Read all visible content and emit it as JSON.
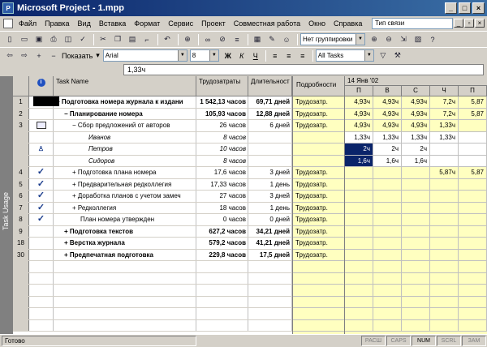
{
  "window": {
    "title": "Microsoft Project - 1.mpp",
    "minimize": "_",
    "maximize": "□",
    "close": "×"
  },
  "menu": {
    "items": [
      "Файл",
      "Правка",
      "Вид",
      "Вставка",
      "Формат",
      "Сервис",
      "Проект",
      "Совместная работа",
      "Окно",
      "Справка"
    ],
    "help_box": "Тип связи"
  },
  "toolbar1": {
    "grouping": "Нет группировки"
  },
  "toolbar2": {
    "show_label": "Показать",
    "font": "Arial",
    "size": "8",
    "bold": "Ж",
    "italic": "К",
    "underline": "Ч",
    "filter": "All Tasks"
  },
  "entry": {
    "value": "1,33ч"
  },
  "viewbar": {
    "label": "Task Usage"
  },
  "table": {
    "headers": {
      "name": "Task Name",
      "work": "Трудозатраты",
      "duration": "Длительност"
    },
    "rows": [
      {
        "id": "1",
        "indicator": "",
        "name": "−  Подготовка номера журнала к издани",
        "work": "1 542,13 часов",
        "duration": "69,71 дней",
        "style": "bold",
        "indent": 0
      },
      {
        "id": "2",
        "indicator": "",
        "name": "−  Планирование номера",
        "work": "105,93 часов",
        "duration": "12,88 дней",
        "style": "bold",
        "indent": 1
      },
      {
        "id": "3",
        "indicator": "note",
        "name": "−  Сбор предложений от авторов",
        "work": "26 часов",
        "duration": "6 дней",
        "style": "normal",
        "indent": 2
      },
      {
        "id": "",
        "indicator": "",
        "name": "Иванов",
        "work": "8 часов",
        "duration": "",
        "style": "italic",
        "indent": 4
      },
      {
        "id": "",
        "indicator": "person",
        "name": "Петров",
        "work": "10 часов",
        "duration": "",
        "style": "italic",
        "indent": 4
      },
      {
        "id": "",
        "indicator": "",
        "name": "Сидоров",
        "work": "8 часов",
        "duration": "",
        "style": "italic",
        "indent": 4
      },
      {
        "id": "4",
        "indicator": "check",
        "name": "+  Подготовка плана номера",
        "work": "17,6 часов",
        "duration": "3 дней",
        "style": "normal",
        "indent": 2
      },
      {
        "id": "5",
        "indicator": "check",
        "name": "+  Предварительная редколлегия",
        "work": "17,33 часов",
        "duration": "1 день",
        "style": "normal",
        "indent": 2
      },
      {
        "id": "6",
        "indicator": "check",
        "name": "+  Доработка планов с учетом замеч",
        "work": "27 часов",
        "duration": "3 дней",
        "style": "normal",
        "indent": 2
      },
      {
        "id": "7",
        "indicator": "check",
        "name": "+  Редколлегия",
        "work": "18 часов",
        "duration": "1 день",
        "style": "normal",
        "indent": 2
      },
      {
        "id": "8",
        "indicator": "check",
        "name": "План номера утвержден",
        "work": "0 часов",
        "duration": "0 дней",
        "style": "normal",
        "indent": 3
      },
      {
        "id": "9",
        "indicator": "",
        "name": "+  Подготовка текстов",
        "work": "627,2 часов",
        "duration": "34,21 дней",
        "style": "bold",
        "indent": 1
      },
      {
        "id": "18",
        "indicator": "",
        "name": "+  Верстка журнала",
        "work": "579,2 часов",
        "duration": "41,21 дней",
        "style": "bold",
        "indent": 1
      },
      {
        "id": "30",
        "indicator": "",
        "name": "+  Предпечатная подготовка",
        "work": "229,8 часов",
        "duration": "17,5 дней",
        "style": "bold",
        "indent": 1
      }
    ]
  },
  "details": {
    "header": "Подробности",
    "label": "Трудозатр."
  },
  "timescale": {
    "week": "14 Янв '02",
    "days": [
      "П",
      "В",
      "С",
      "Ч",
      "П"
    ],
    "rows": [
      [
        "4,93ч",
        "4,93ч",
        "4,93ч",
        "7,2ч",
        "5,87"
      ],
      [
        "4,93ч",
        "4,93ч",
        "4,93ч",
        "7,2ч",
        "5,87"
      ],
      [
        "4,93ч",
        "4,93ч",
        "4,93ч",
        "1,33ч",
        ""
      ],
      [
        "1,33ч",
        "1,33ч",
        "1,33ч",
        "1,33ч",
        ""
      ],
      [
        "2ч",
        "2ч",
        "2ч",
        "",
        ""
      ],
      [
        "1,6ч",
        "1,6ч",
        "1,6ч",
        "",
        ""
      ],
      [
        "",
        "",
        "",
        "5,87ч",
        "5,87"
      ]
    ]
  },
  "status": {
    "text": "Готово",
    "indicators": [
      "РАСШ",
      "CAPS",
      "NUM",
      "SCRL",
      "ЗАМ"
    ]
  }
}
